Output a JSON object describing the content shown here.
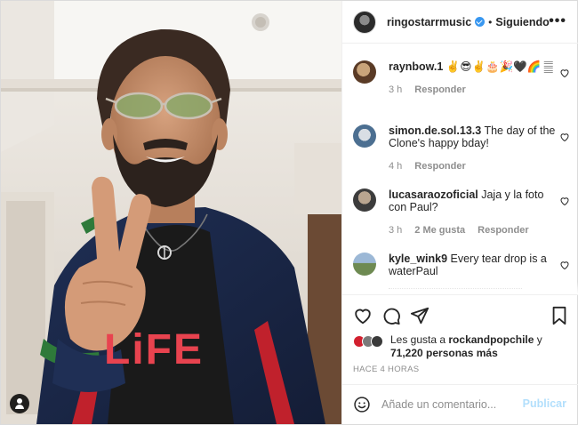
{
  "post": {
    "author": "ringostarrmusic",
    "separator": "•",
    "follow_label": "Siguiendo",
    "more_icon": "more-horizontal-icon",
    "verified_icon": "verified-badge-icon",
    "photo": {
      "shirt_text": "LiFE",
      "description_icon": "user-tag-icon"
    }
  },
  "comments": [
    {
      "user": "raynbow.1",
      "text": "✌️😎✌️🎂🎉🖤🌈 𝄛",
      "time": "3 h",
      "reply": "Responder",
      "likes": ""
    },
    {
      "user": "simon.de.sol.13.3",
      "text": "The day of the Clone's happy bday!",
      "time": "4 h",
      "reply": "Responder",
      "likes": ""
    },
    {
      "user": "lucasaraozoficial",
      "text": "Jaja y la foto con Paul?",
      "time": "3 h",
      "reply": "Responder",
      "likes": "2 Me gusta"
    },
    {
      "user": "kyle_wink9",
      "text": "Every tear drop is a waterPaul",
      "time": "",
      "reply": "",
      "likes": ""
    }
  ],
  "likes": {
    "prefix": "Les gusta a",
    "user": "rockandpopchile",
    "conj": "y",
    "count": "71,220 personas más"
  },
  "timestamp": "HACE 4 HORAS",
  "composer": {
    "placeholder": "Añade un comentario...",
    "publish_label": "Publicar"
  },
  "colors": {
    "accent": "#3897f0",
    "publish_disabled": "#b2dffc",
    "shirt_text": "#e8434f"
  }
}
